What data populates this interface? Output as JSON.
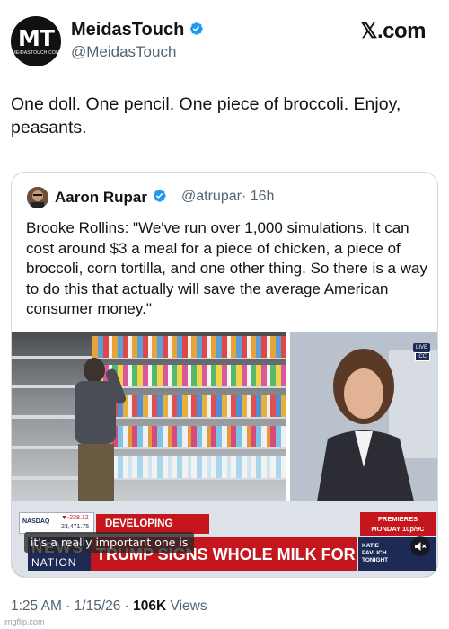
{
  "author": {
    "avatar_text": "MT",
    "avatar_subtext": "MEIDASTOUCH.COM",
    "display_name": "MeidasTouch",
    "handle": "@MeidasTouch",
    "verified": true
  },
  "brand": {
    "label": "𝕏.com"
  },
  "post": {
    "text": "One doll. One pencil. One piece of broccoli. Enjoy, peasants."
  },
  "quoted_post": {
    "display_name": "Aaron Rupar",
    "handle": "@atrupar",
    "time": "· 16h",
    "verified": true,
    "text": "Brooke Rollins: \"We've run over 1,000 simulations. It can cost around $3 a meal for a piece of chicken, a piece of broccoli, corn tortilla, and one other thing. So there is a way to do this that actually will save the average American consumer money.\"",
    "video": {
      "live_badge": "LIVE",
      "cc_badge": "CC",
      "nasdaq_label": "NASDAQ",
      "nasdaq_change": "▼-238.12",
      "nasdaq_value": "23,471.75",
      "developing_label": "DEVELOPING STORY",
      "premieres_line1": "PREMIERES",
      "premieres_line2": "MONDAY 10p/9C",
      "network_line1": "NEWS",
      "network_line2": "NATION",
      "headline": "TRUMP SIGNS WHOLE MILK FOR HEALTHY KIDS ACT",
      "katie_line1": "KATIE",
      "katie_line2": "PAVLICH",
      "katie_line3": "TONIGHT",
      "caption": "it's a really important one is"
    }
  },
  "meta": {
    "time": "1:25 AM",
    "separator1": " · ",
    "date": "1/15/26",
    "separator2": " · ",
    "views_count": "106K",
    "views_label": " Views"
  },
  "watermark": "imgflip.com",
  "colors": {
    "verified_blue": "#1d9bf0",
    "text_primary": "#0f1419",
    "text_secondary": "#536471",
    "news_red": "#c4161c",
    "news_navy": "#1c2a55"
  }
}
